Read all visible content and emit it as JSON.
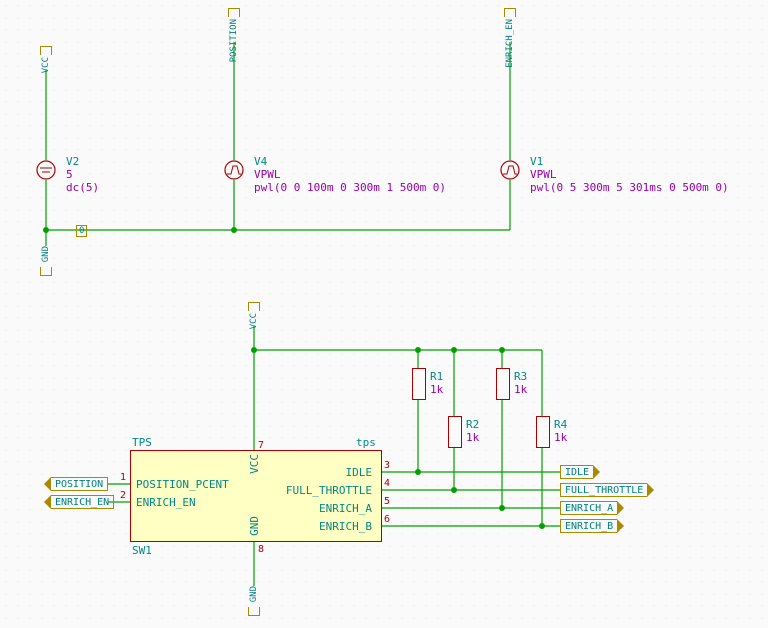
{
  "domain": "Diagram / Schematic (KiCad-style)",
  "power_rails": {
    "vcc": "VCC",
    "gnd": "GND",
    "position": "POSITION",
    "enrich_en": "ENRICH_EN",
    "zero": "0"
  },
  "sources": {
    "V2": {
      "ref": "V2",
      "value": "5",
      "spice": "dc(5)",
      "pos_net": "VCC",
      "neg_net": "GND"
    },
    "V4": {
      "ref": "V4",
      "value": "VPWL",
      "spice": "pwl(0 0 100m 0 300m 1 500m 0)",
      "pos_net": "POSITION",
      "neg_net": "GND"
    },
    "V1": {
      "ref": "V1",
      "value": "VPWL",
      "spice": "pwl(0 5 300m 5 301ms 0 500m 0)",
      "pos_net": "ENRICH_EN",
      "neg_net": "GND"
    }
  },
  "resistors": {
    "R1": {
      "ref": "R1",
      "value": "1k"
    },
    "R2": {
      "ref": "R2",
      "value": "1k"
    },
    "R3": {
      "ref": "R3",
      "value": "1k"
    },
    "R4": {
      "ref": "R4",
      "value": "1k"
    }
  },
  "chip": {
    "ref": "SW1",
    "type_label": "TPS",
    "instance_label": "tps",
    "pins": {
      "1": {
        "name": "POSITION_PCENT",
        "net": "POSITION"
      },
      "2": {
        "name": "ENRICH_EN",
        "net": "ENRICH_EN"
      },
      "3": {
        "name": "IDLE",
        "net": "IDLE"
      },
      "4": {
        "name": "FULL_THROTTLE",
        "net": "FULL_THROTTLE"
      },
      "5": {
        "name": "ENRICH_A",
        "net": "ENRICH_A"
      },
      "6": {
        "name": "ENRICH_B",
        "net": "ENRICH_B"
      },
      "7": {
        "name": "VCC",
        "net": "VCC"
      },
      "8": {
        "name": "GND",
        "net": "GND"
      }
    }
  },
  "output_nets": [
    "IDLE",
    "FULL_THROTTLE",
    "ENRICH_A",
    "ENRICH_B"
  ]
}
